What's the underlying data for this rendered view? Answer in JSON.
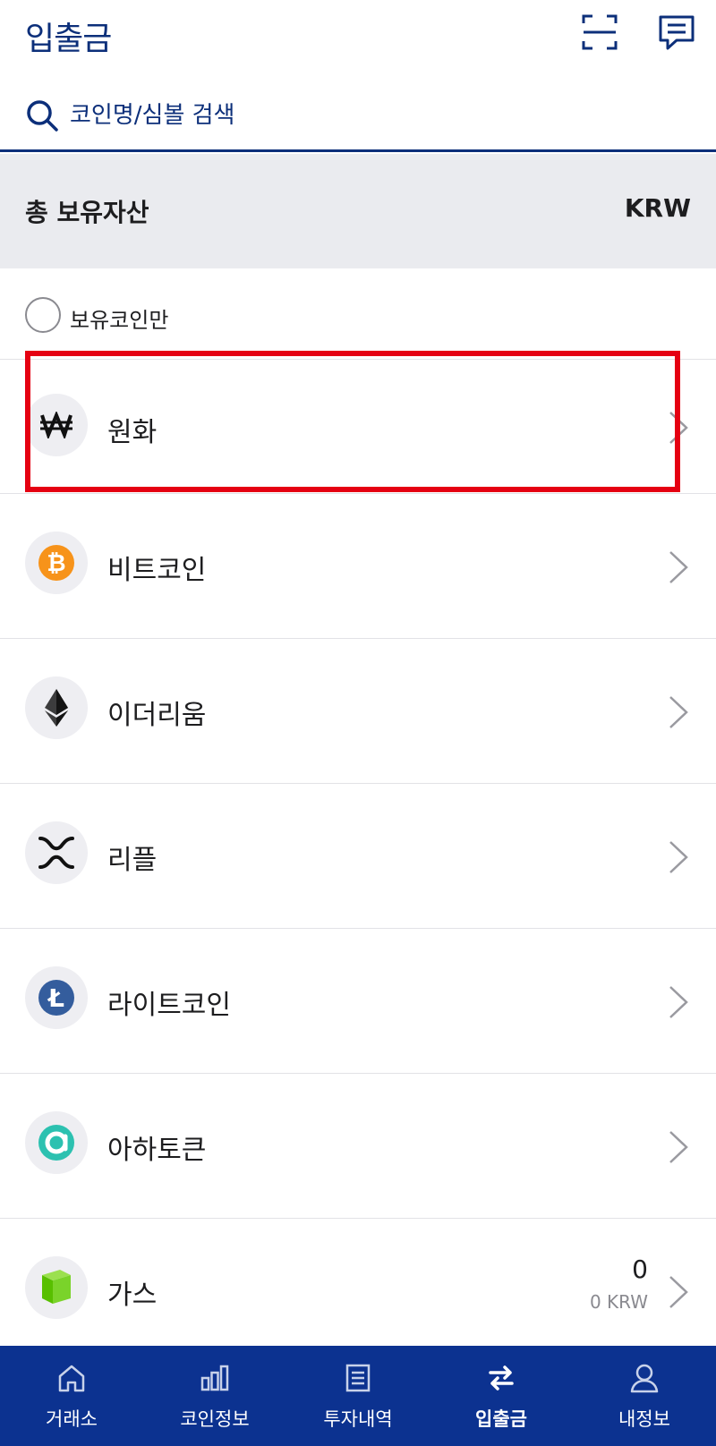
{
  "header": {
    "title": "입출금"
  },
  "search": {
    "placeholder": "코인명/심볼 검색"
  },
  "summary": {
    "label": "총 보유자산",
    "unit": "KRW"
  },
  "filter": {
    "label": "보유코인만",
    "checked": false
  },
  "coins": [
    {
      "name": "원화",
      "icon": "won-icon",
      "highlighted": true
    },
    {
      "name": "비트코인",
      "icon": "bitcoin-icon"
    },
    {
      "name": "이더리움",
      "icon": "ethereum-icon"
    },
    {
      "name": "리플",
      "icon": "ripple-icon"
    },
    {
      "name": "라이트코인",
      "icon": "litecoin-icon"
    },
    {
      "name": "아하토큰",
      "icon": "aha-token-icon"
    },
    {
      "name": "가스",
      "icon": "gas-icon",
      "amount": "0",
      "krw": "0 KRW"
    }
  ],
  "tabs": [
    {
      "label": "거래소",
      "icon": "home-icon"
    },
    {
      "label": "코인정보",
      "icon": "chart-icon"
    },
    {
      "label": "투자내역",
      "icon": "document-icon"
    },
    {
      "label": "입출금",
      "icon": "transfer-icon",
      "active": true
    },
    {
      "label": "내정보",
      "icon": "user-icon"
    }
  ],
  "colors": {
    "brand": "#0c2f7a",
    "tabbar": "#0c3290",
    "highlight": "#e50012",
    "bitcoin": "#f7931a",
    "litecoin": "#345d9d",
    "aha": "#2cc1b0",
    "gas": "#58bf00"
  }
}
